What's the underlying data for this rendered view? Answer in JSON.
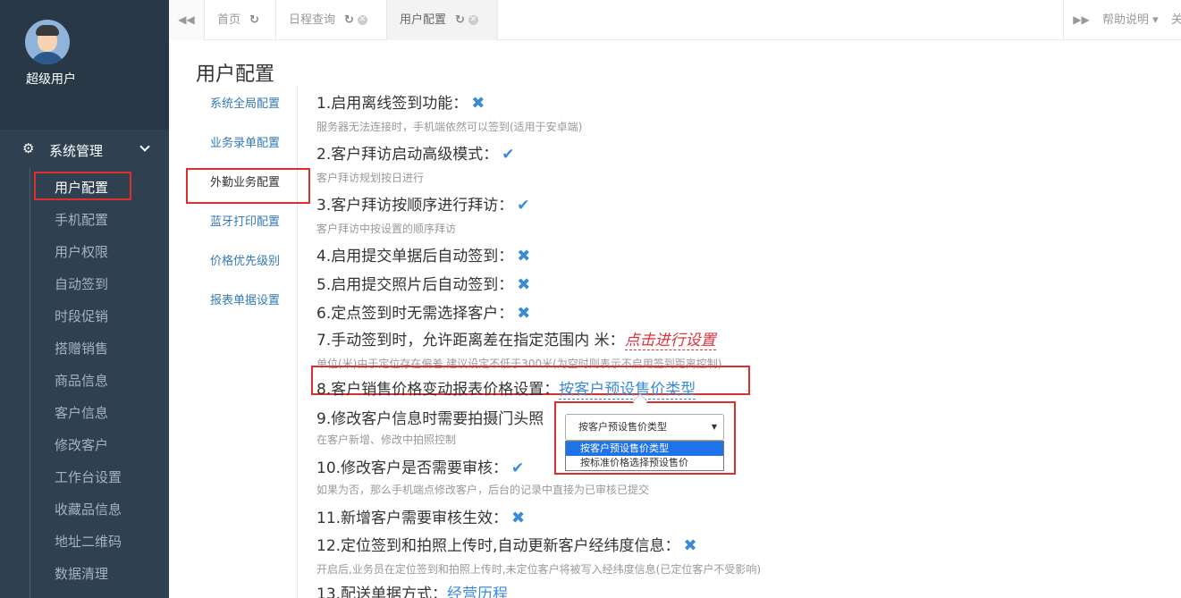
{
  "sidebar": {
    "username": "超级用户",
    "menu_head": "系统管理",
    "items": [
      {
        "label": "用户配置",
        "active": true
      },
      {
        "label": "手机配置"
      },
      {
        "label": "用户权限"
      },
      {
        "label": "自动签到"
      },
      {
        "label": "时段促销"
      },
      {
        "label": "搭赠销售"
      },
      {
        "label": "商品信息"
      },
      {
        "label": "客户信息"
      },
      {
        "label": "修改客户"
      },
      {
        "label": "工作台设置"
      },
      {
        "label": "收藏品信息"
      },
      {
        "label": "地址二维码"
      },
      {
        "label": "数据清理"
      }
    ]
  },
  "tabs": [
    {
      "label": "首页"
    },
    {
      "label": "日程查询"
    },
    {
      "label": "用户配置",
      "active": true
    }
  ],
  "tabbar": {
    "help": "帮助说明",
    "close_all": "关"
  },
  "page": {
    "title": "用户配置"
  },
  "subnav": [
    {
      "label": "系统全局配置"
    },
    {
      "label": "业务录单配置"
    },
    {
      "label": "外勤业务配置",
      "active": true
    },
    {
      "label": "蓝牙打印配置"
    },
    {
      "label": "价格优先级别"
    },
    {
      "label": "报表单据设置"
    }
  ],
  "settings": [
    {
      "label": "1.启用离线签到功能：",
      "state": "off",
      "hint": "服务器无法连接时，手机端依然可以签到(适用于安卓端)"
    },
    {
      "label": "2.客户拜访启动高级模式：",
      "state": "on",
      "hint": "客户拜访规划按日进行"
    },
    {
      "label": "3.客户拜访按顺序进行拜访：",
      "state": "on",
      "hint": "客户拜访中按设置的顺序拜访"
    },
    {
      "label": "4.启用提交单据后自动签到：",
      "state": "off"
    },
    {
      "label": "5.启用提交照片后自动签到：",
      "state": "off"
    },
    {
      "label": "6.定点签到时无需选择客户：",
      "state": "off"
    },
    {
      "label": "7.手动签到时，允许距离差在指定范围内 米：",
      "link": "点击进行设置",
      "hint": "单位(米)由于定位存在偏差,建议设定不低于300米(为空时则表示不启用签到距离控制)"
    },
    {
      "label": "8.客户销售价格变动报表价格设置：",
      "value": "按客户预设售价类型"
    },
    {
      "label": "9.修改客户信息时需要拍摄门头照",
      "hint": "在客户新增、修改中拍照控制"
    },
    {
      "label": "10.修改客户是否需要审核：",
      "state": "on",
      "hint": "如果为否，那么手机端点修改客户，后台的记录中直接为已审核已提交"
    },
    {
      "label": "11.新增客户需要审核生效：",
      "state": "off"
    },
    {
      "label": "12.定位签到和拍照上传时,自动更新客户经纬度信息：",
      "state": "off",
      "hint": "开启后,业务员在定位签到和拍照上传时,未定位客户将被写入经纬度信息(已定位客户不受影响)"
    },
    {
      "label": "13.配送单据方式：",
      "value": "经营历程"
    }
  ],
  "dropdown": {
    "selected": "按客户预设售价类型",
    "options": [
      "按客户预设售价类型",
      "按标准价格选择预设售价"
    ]
  },
  "icons": {
    "on": "✔",
    "off": "✖"
  },
  "colors": {
    "sidebar_bg": "#2f4050",
    "accent_blue": "#3a8ad6",
    "highlight_red": "#e02e2e",
    "link_red": "#d9343a"
  }
}
